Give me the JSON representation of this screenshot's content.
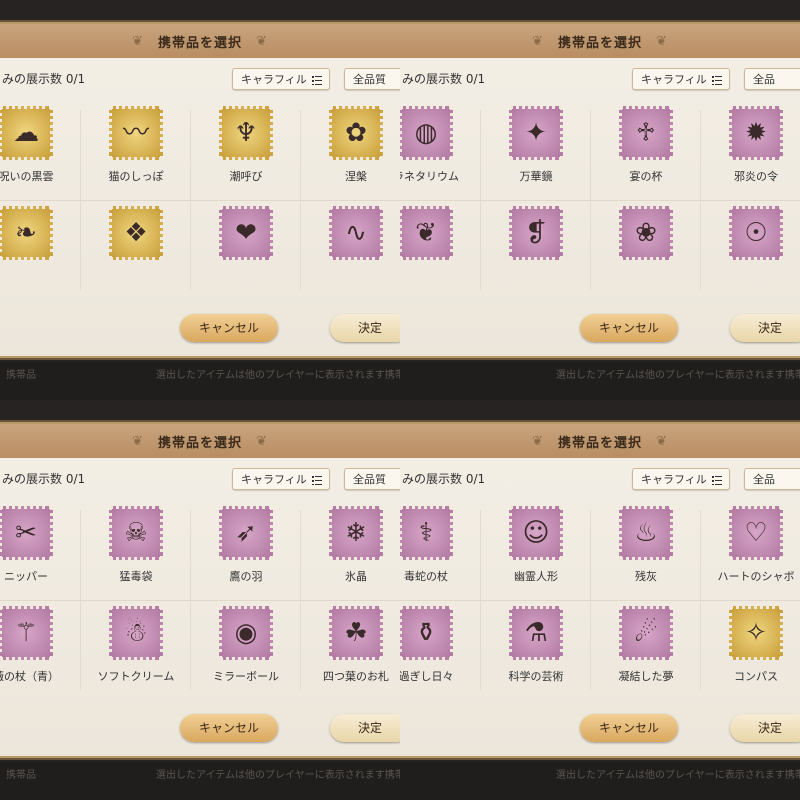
{
  "colors": {
    "header_bg": "#c8a47d",
    "panel_bg": "#f4efe6",
    "stamp_purple": "#c48cb5",
    "stamp_gold": "#d9b453",
    "button_gold": "#e7bd78"
  },
  "screens": [
    {
      "header_title": "携帯品を選択",
      "display_count": "みの展示数 0/1",
      "filter_label": "キャラフィル",
      "quality_label": "全品質",
      "items": [
        {
          "name": "呪いの黒雲",
          "icon": "dark-cloud-orb-icon",
          "frame": "gold",
          "glyph": "☁"
        },
        {
          "name": "猫のしっぽ",
          "icon": "cat-tail-icon",
          "frame": "gold",
          "glyph": "〰"
        },
        {
          "name": "潮呼び",
          "icon": "tide-caller-icon",
          "frame": "gold",
          "glyph": "♆"
        },
        {
          "name": "涅槃",
          "icon": "nirvana-icon",
          "frame": "gold",
          "glyph": "✿"
        },
        {
          "name": "",
          "icon": "dark-feather-icon",
          "frame": "gold",
          "glyph": "❧"
        },
        {
          "name": "",
          "icon": "crystal-shard-icon",
          "frame": "gold",
          "glyph": "❖"
        },
        {
          "name": "",
          "icon": "red-cushion-icon",
          "frame": "purple",
          "glyph": "❤"
        },
        {
          "name": "",
          "icon": "black-scarf-icon",
          "frame": "purple",
          "glyph": "∿"
        }
      ],
      "cancel_label": "キャンセル",
      "ok_label": "決定",
      "footer_left": "携帯品",
      "footer_right": "選出したアイテムは他のプレイヤーに表示されます携帯品"
    },
    {
      "header_title": "携帯品を選択",
      "display_count": "みの展示数 0/1",
      "filter_label": "キャラフィル",
      "quality_label": "全品",
      "items": [
        {
          "name": "ラネタリウム",
          "icon": "planetarium-ring-icon",
          "frame": "purple",
          "glyph": "◍"
        },
        {
          "name": "万華鏡",
          "icon": "kaleidoscope-icon",
          "frame": "purple",
          "glyph": "✦"
        },
        {
          "name": "宴の杯",
          "icon": "banquet-goblet-icon",
          "frame": "purple",
          "glyph": "♱"
        },
        {
          "name": "邪炎の令",
          "icon": "evil-flame-icon",
          "frame": "purple",
          "glyph": "✹"
        },
        {
          "name": "",
          "icon": "fox-charm-icon",
          "frame": "purple",
          "glyph": "❦"
        },
        {
          "name": "",
          "icon": "red-curtain-icon",
          "frame": "purple",
          "glyph": "❡"
        },
        {
          "name": "",
          "icon": "candy-jar-icon",
          "frame": "purple",
          "glyph": "❀"
        },
        {
          "name": "",
          "icon": "golden-mirror-icon",
          "frame": "purple",
          "glyph": "☉"
        }
      ],
      "cancel_label": "キャンセル",
      "ok_label": "決定",
      "footer_left": "",
      "footer_right": "選出したアイテムは他のプレイヤーに表示されます携帯品"
    },
    {
      "header_title": "携帯品を選択",
      "display_count": "みの展示数 0/1",
      "filter_label": "キャラフィル",
      "quality_label": "全品質",
      "items": [
        {
          "name": "ニッパー",
          "icon": "pliers-icon",
          "frame": "purple",
          "glyph": "✂"
        },
        {
          "name": "猛毒袋",
          "icon": "poison-bag-icon",
          "frame": "purple",
          "glyph": "☠"
        },
        {
          "name": "鷹の羽",
          "icon": "hawk-feather-icon",
          "frame": "purple",
          "glyph": "➶"
        },
        {
          "name": "氷晶",
          "icon": "ice-crystal-icon",
          "frame": "purple",
          "glyph": "❄"
        },
        {
          "name": "薇の杖（青）",
          "icon": "rose-staff-blue-icon",
          "frame": "purple",
          "glyph": "⚚"
        },
        {
          "name": "ソフトクリーム",
          "icon": "soft-cream-icon",
          "frame": "purple",
          "glyph": "☃"
        },
        {
          "name": "ミラーボール",
          "icon": "mirror-ball-icon",
          "frame": "purple",
          "glyph": "◉"
        },
        {
          "name": "四つ葉のお札",
          "icon": "four-leaf-charm-icon",
          "frame": "purple",
          "glyph": "☘"
        }
      ],
      "cancel_label": "キャンセル",
      "ok_label": "決定",
      "footer_left": "携帯品",
      "footer_right": "選出したアイテムは他のプレイヤーに表示されます携帯品"
    },
    {
      "header_title": "携帯品を選択",
      "display_count": "みの展示数 0/1",
      "filter_label": "キャラフィル",
      "quality_label": "全品",
      "items": [
        {
          "name": "毒蛇の杖",
          "icon": "viper-staff-icon",
          "frame": "purple",
          "glyph": "⚕"
        },
        {
          "name": "幽霊人形",
          "icon": "ghost-doll-icon",
          "frame": "purple",
          "glyph": "☺"
        },
        {
          "name": "残灰",
          "icon": "ash-torch-icon",
          "frame": "purple",
          "glyph": "♨"
        },
        {
          "name": "ハートのシャボ",
          "icon": "heart-bubble-wand-icon",
          "frame": "purple",
          "glyph": "♡"
        },
        {
          "name": "過ぎし日々",
          "icon": "watering-can-icon",
          "frame": "purple",
          "glyph": "⚱"
        },
        {
          "name": "科学の芸術",
          "icon": "science-art-icon",
          "frame": "purple",
          "glyph": "⚗"
        },
        {
          "name": "凝結した夢",
          "icon": "dream-bottle-icon",
          "frame": "purple",
          "glyph": "☄"
        },
        {
          "name": "コンパス",
          "icon": "compass-icon",
          "frame": "gold",
          "glyph": "✧"
        }
      ],
      "cancel_label": "キャンセル",
      "ok_label": "決定",
      "footer_left": "",
      "footer_right": "選出したアイテムは他のプレイヤーに表示されます携帯品"
    }
  ]
}
